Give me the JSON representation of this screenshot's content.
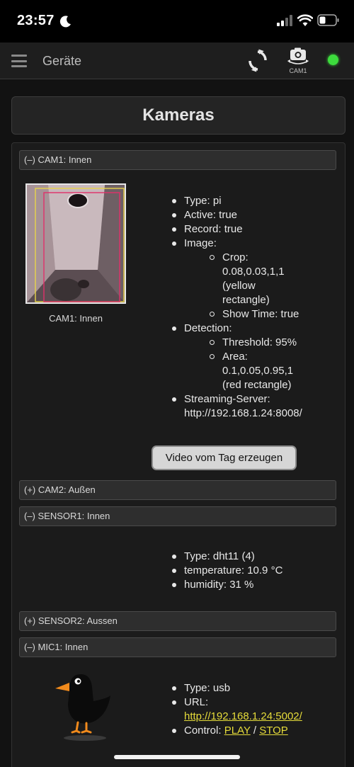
{
  "status_bar": {
    "time": "23:57"
  },
  "nav": {
    "title": "Geräte",
    "cam_label": "CAM1"
  },
  "page_title": "Kameras",
  "sections": {
    "cam1": {
      "header": "(–) CAM1: Innen",
      "caption": "CAM1: Innen",
      "type": "Type: pi",
      "active": "Active: true",
      "record": "Record: true",
      "image": "Image:",
      "crop": "Crop: 0.08,0.03,1,1 (yellow rectangle)",
      "show_time": "Show Time: true",
      "detection": "Detection:",
      "threshold": "Threshold: 95%",
      "area": "Area: 0.1,0.05,0.95,1 (red rectangle)",
      "streaming": "Streaming-Server: http://192.168.1.24:8008/",
      "button": "Video vom Tag erzeugen"
    },
    "cam2": {
      "header": "(+) CAM2: Außen"
    },
    "sensor1": {
      "header": "(–) SENSOR1: Innen",
      "type": "Type: dht11 (4)",
      "temperature": "temperature: 10.9 °C",
      "humidity": "humidity: 31 %"
    },
    "sensor2": {
      "header": "(+) SENSOR2: Aussen"
    },
    "mic1": {
      "header": "(–) MIC1: Innen",
      "type": "Type: usb",
      "url_label": "URL:",
      "url": "http://192.168.1.24:5002/",
      "control_label": "Control:",
      "play": "PLAY",
      "separator": "/",
      "stop": "STOP"
    }
  },
  "colors": {
    "background": "#121212",
    "link": "#e6dc3a",
    "status_ok": "#3ddc3d",
    "crop_rect": "#e8d44a",
    "detection_rect": "#e0306a"
  },
  "icons": [
    "moon-icon",
    "signal-icon",
    "wifi-icon",
    "battery-icon",
    "menu-icon",
    "reload-icon",
    "camera-switch-icon",
    "bird-icon"
  ]
}
